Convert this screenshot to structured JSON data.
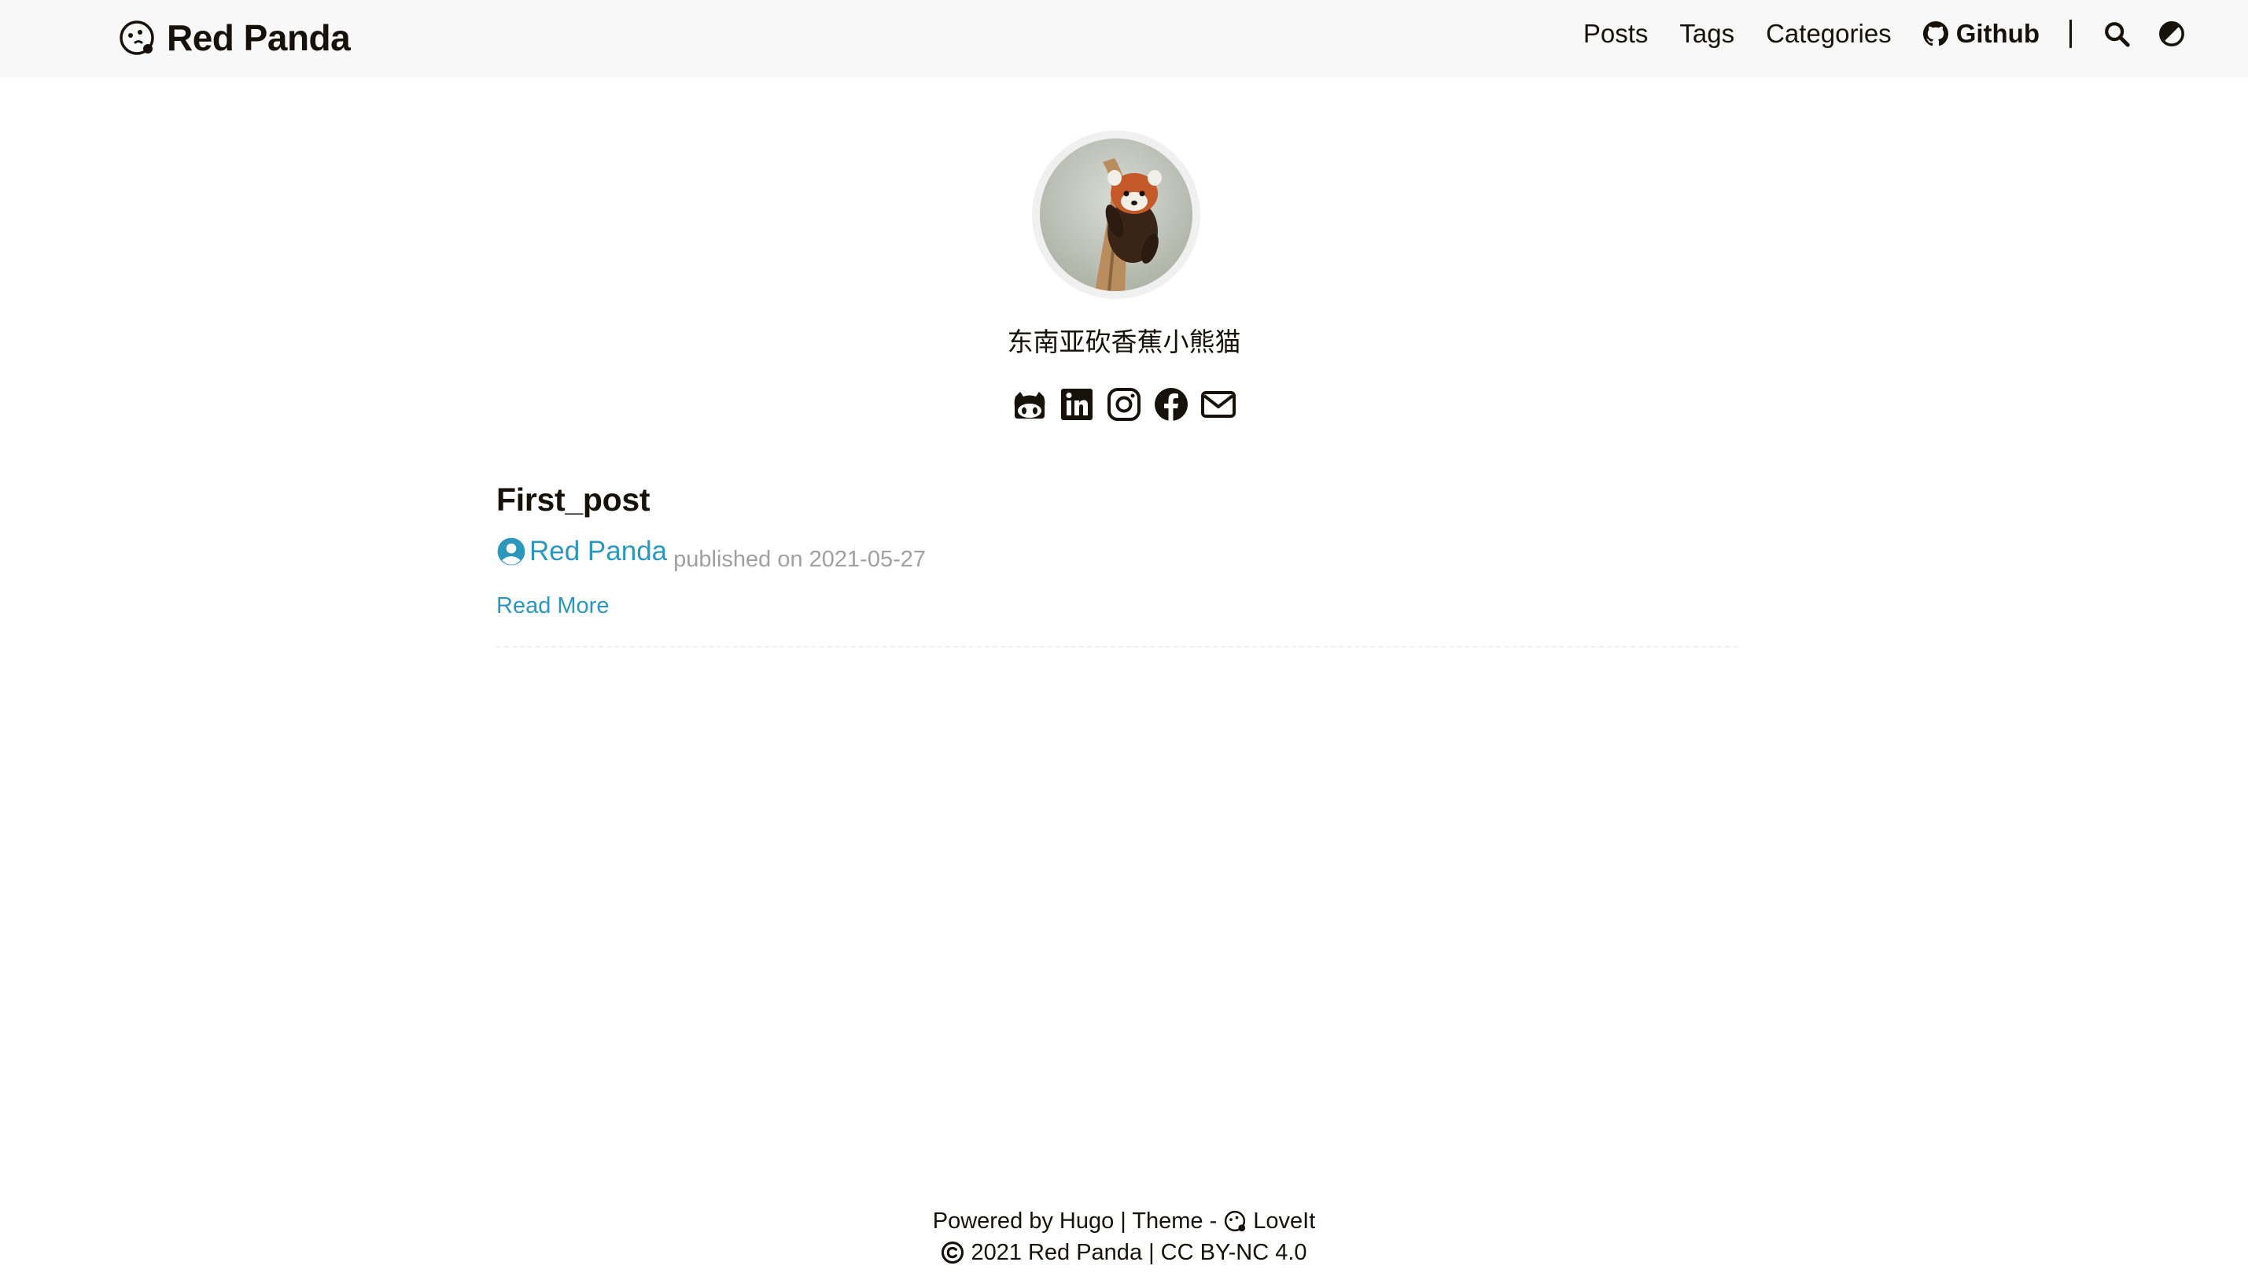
{
  "brand": {
    "name": "Red Panda",
    "logo_icon": "panda-face-icon"
  },
  "nav": {
    "items": [
      {
        "label": "Posts"
      },
      {
        "label": "Tags"
      },
      {
        "label": "Categories"
      }
    ],
    "github_label": "Github",
    "search_icon": "search-icon",
    "theme_icon": "theme-toggle-icon"
  },
  "profile": {
    "subtitle": "东南亚砍香蕉小熊猫",
    "social_icons": [
      "github-icon",
      "linkedin-icon",
      "instagram-icon",
      "facebook-icon",
      "email-icon"
    ]
  },
  "post": {
    "title": "First_post",
    "author": "Red Panda",
    "published_text": "published on 2021-05-27",
    "read_more": "Read More"
  },
  "footer": {
    "powered_by": "Powered by",
    "hugo": "Hugo",
    "theme_prefix": "| Theme -",
    "theme_name": "LoveIt",
    "copyright_year": "2021",
    "copyright_owner": "Red Panda",
    "license": "| CC BY-NC 4.0"
  },
  "colors": {
    "accent": "#2d96bd",
    "text": "#161209",
    "muted": "#a0a0a0",
    "header_bg": "#f8f8f8"
  }
}
